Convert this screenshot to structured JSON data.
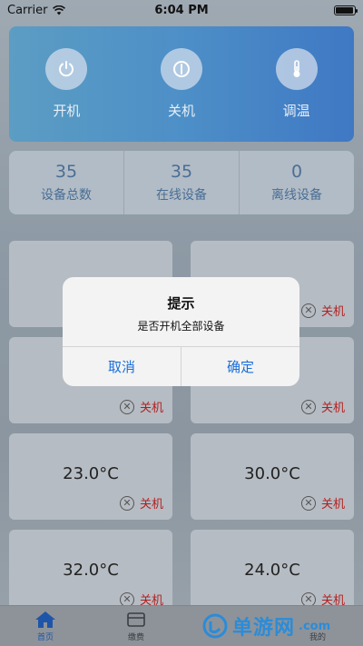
{
  "status_bar": {
    "carrier": "Carrier",
    "time": "6:04 PM"
  },
  "controls": [
    {
      "label": "开机",
      "icon": "power-icon"
    },
    {
      "label": "关机",
      "icon": "power-off-icon"
    },
    {
      "label": "调温",
      "icon": "thermometer-icon"
    }
  ],
  "stats": [
    {
      "value": "35",
      "label": "设备总数"
    },
    {
      "value": "35",
      "label": "在线设备"
    },
    {
      "value": "0",
      "label": "离线设备"
    }
  ],
  "devices": [
    {
      "temp": "",
      "status": ""
    },
    {
      "temp": "",
      "status": "关机"
    },
    {
      "temp": "",
      "status": "关机"
    },
    {
      "temp": "",
      "status": "关机"
    },
    {
      "temp": "23.0°C",
      "status": "关机"
    },
    {
      "temp": "30.0°C",
      "status": "关机"
    },
    {
      "temp": "32.0°C",
      "status": "关机"
    },
    {
      "temp": "24.0°C",
      "status": "关机"
    }
  ],
  "dialog": {
    "title": "提示",
    "message": "是否开机全部设备",
    "cancel": "取消",
    "confirm": "确定"
  },
  "tabbar": [
    {
      "label": "首页",
      "active": true
    },
    {
      "label": "缴费",
      "active": false
    },
    {
      "label": "",
      "active": false
    },
    {
      "label": "我的",
      "active": false
    }
  ],
  "watermark": {
    "brand": "单游网",
    "suffix": ".com"
  },
  "colors": {
    "accent_blue": "#1a6fd8",
    "status_red": "#b32020",
    "card_gradient_start": "#5b9dc3",
    "card_gradient_end": "#3f78c4"
  }
}
